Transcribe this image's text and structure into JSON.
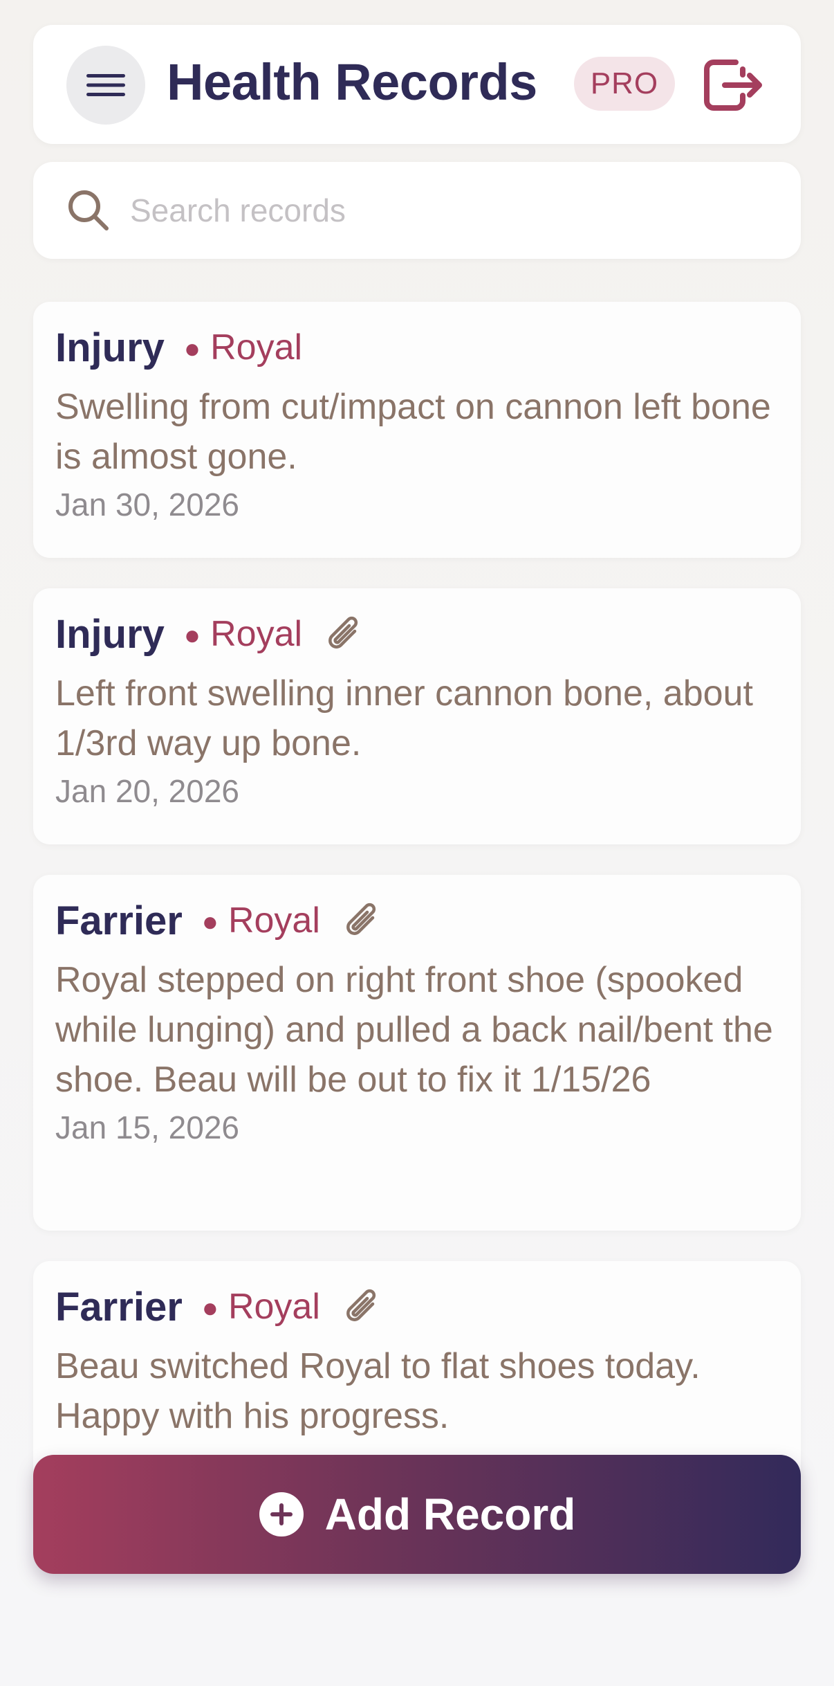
{
  "header": {
    "title": "Health Records",
    "badge": "PRO",
    "menu_icon": "hamburger-menu-icon",
    "logout_icon": "logout-icon"
  },
  "search": {
    "placeholder": "Search records",
    "value": "",
    "icon": "search-icon"
  },
  "records": [
    {
      "type": "Injury",
      "horse": "Royal",
      "has_attachment": false,
      "description": "Swelling from cut/impact on cannon left bone is almost gone.",
      "date": "Jan 30, 2026"
    },
    {
      "type": "Injury",
      "horse": "Royal",
      "has_attachment": true,
      "description": "Left front swelling inner cannon bone, about 1/3rd way up bone.",
      "date": "Jan 20, 2026"
    },
    {
      "type": "Farrier",
      "horse": "Royal",
      "has_attachment": true,
      "description": "Royal stepped on right front shoe (spooked while lunging) and pulled a back nail/bent the shoe. Beau will be out to fix it 1/15/26",
      "date": "Jan 15, 2026"
    },
    {
      "type": "Farrier",
      "horse": "Royal",
      "has_attachment": true,
      "description": "Beau switched Royal to flat shoes today. Happy with his progress.",
      "date": ""
    }
  ],
  "add_button": {
    "label": "Add Record",
    "icon": "plus-circle-icon"
  },
  "colors": {
    "primary_navy": "#2f2b57",
    "accent_rose": "#a43e5d",
    "desc_brown": "#8a7468",
    "date_gray": "#8f8b8f",
    "badge_bg": "#f4e4e8"
  }
}
